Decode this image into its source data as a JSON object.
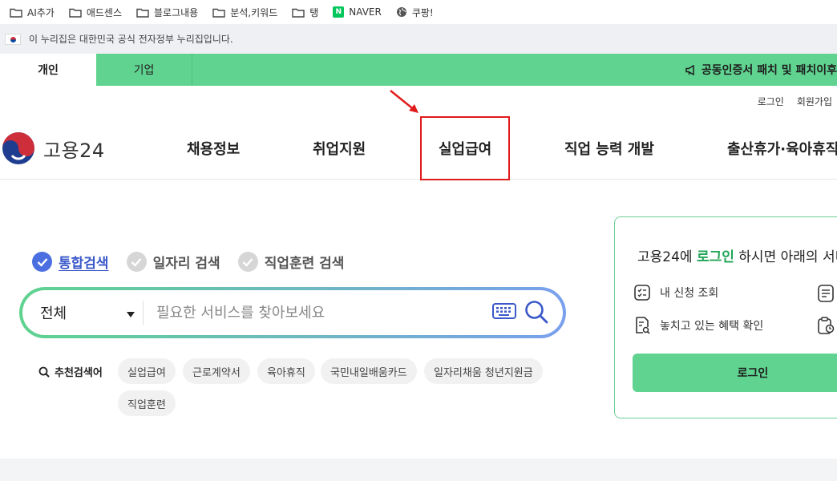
{
  "bookmarks": [
    {
      "label": "AI추가",
      "icon": "folder-icon"
    },
    {
      "label": "애드센스",
      "icon": "folder-icon"
    },
    {
      "label": "블로그내용",
      "icon": "folder-icon"
    },
    {
      "label": "분석,키워드",
      "icon": "folder-icon"
    },
    {
      "label": "탱",
      "icon": "folder-icon"
    },
    {
      "label": "NAVER",
      "icon": "naver-icon",
      "badge": "N"
    },
    {
      "label": "쿠팡!",
      "icon": "globe-icon"
    }
  ],
  "gov_banner": {
    "text": "이 누리집은 대한민국 공식 전자정부 누리집입니다."
  },
  "top_tabs": [
    {
      "label": "개인",
      "active": true
    },
    {
      "label": "기업",
      "active": false
    }
  ],
  "notice": {
    "text": "공동인증서 패치 및 패치이후"
  },
  "util_links": {
    "login": "로그인",
    "signup": "회원가입"
  },
  "logo": {
    "text": "고용24"
  },
  "nav": [
    {
      "label": "채용정보"
    },
    {
      "label": "취업지원"
    },
    {
      "label": "실업급여",
      "highlighted": true
    },
    {
      "label": "직업 능력 개발"
    },
    {
      "label": "출산휴가·육아휴직"
    }
  ],
  "search": {
    "types": [
      {
        "label": "통합검색",
        "selected": true
      },
      {
        "label": "일자리 검색",
        "selected": false
      },
      {
        "label": "직업훈련 검색",
        "selected": false
      }
    ],
    "category": "전체",
    "placeholder": "필요한 서비스를 찾아보세요",
    "value": ""
  },
  "recommended": {
    "label": "추천검색어",
    "items": [
      "실업급여",
      "근로계약서",
      "육아휴직",
      "국민내일배움카드",
      "일자리채움 청년지원금",
      "직업훈련"
    ]
  },
  "login_panel": {
    "title_prefix": "고용24에 ",
    "title_highlight": "로그인",
    "title_suffix": " 하시면 아래의 서비스를",
    "items": [
      {
        "label": "내 신청 조회",
        "icon": "checklist-icon"
      },
      {
        "label": "놓치고 있는 혜택 확인",
        "icon": "document-search-icon"
      }
    ],
    "button": "로그인"
  },
  "colors": {
    "brand_green": "#5fd38f",
    "accent_blue": "#4b6fe0",
    "highlight_red": "#e01b1b"
  }
}
